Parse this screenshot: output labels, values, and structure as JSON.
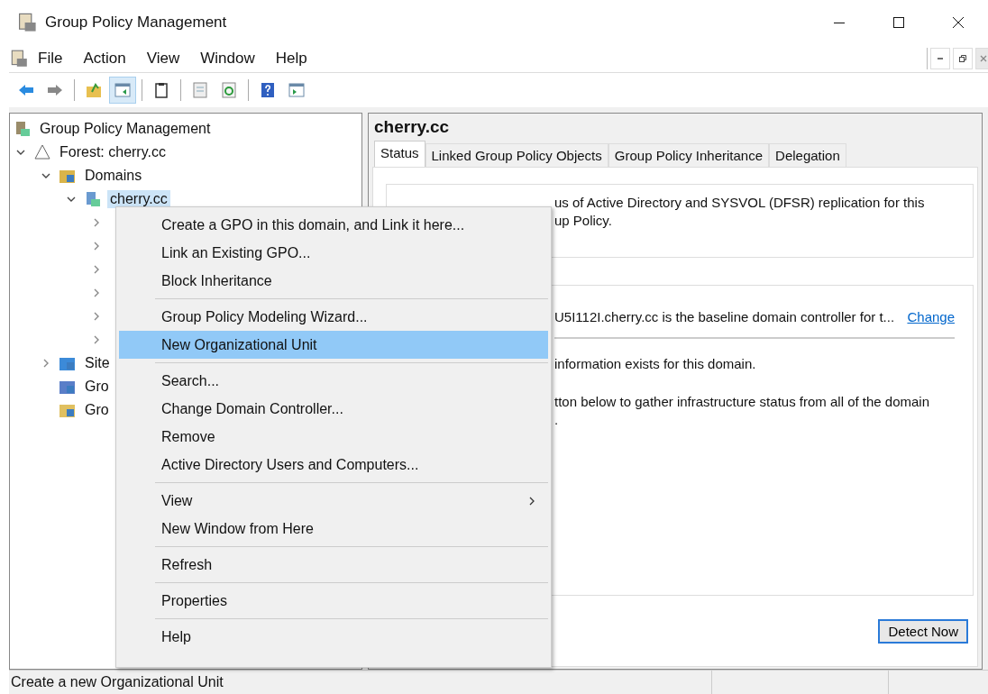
{
  "window": {
    "title": "Group Policy Management"
  },
  "menu_bar": [
    "File",
    "Action",
    "View",
    "Window",
    "Help"
  ],
  "toolbar": [
    {
      "kind": "back",
      "selected": false
    },
    {
      "kind": "forward",
      "selected": false
    },
    {
      "kind": "up",
      "selected": false
    },
    {
      "kind": "tree",
      "selected": true
    },
    {
      "kind": "clipboard",
      "selected": false
    },
    {
      "kind": "export",
      "selected": false
    },
    {
      "kind": "refresh",
      "selected": false
    },
    {
      "kind": "help",
      "selected": false
    },
    {
      "kind": "action",
      "selected": false
    }
  ],
  "tree": [
    {
      "label": "Group Policy Management",
      "kind": "root",
      "selected": false,
      "children": [
        {
          "label": "Forest: cherry.cc",
          "kind": "forest",
          "expanded": true,
          "selected": false,
          "children": [
            {
              "label": "Domains",
              "kind": "domains",
              "expanded": true,
              "selected": false,
              "children": [
                {
                  "label": "cherry.cc",
                  "kind": "domain",
                  "expanded": true,
                  "selected": true,
                  "children": [
                    {
                      "expanded": false
                    },
                    {
                      "expanded": false
                    },
                    {
                      "expanded": false
                    },
                    {
                      "expanded": false
                    },
                    {
                      "expanded": false
                    },
                    {
                      "expanded": false
                    }
                  ]
                }
              ]
            },
            {
              "label": "Site",
              "kind": "sites",
              "expanded": false,
              "selected": false
            },
            {
              "label": "Gro",
              "kind": "gpo",
              "selected": false
            },
            {
              "label": "Gro",
              "kind": "starter",
              "selected": false
            }
          ]
        }
      ]
    }
  ],
  "details": {
    "heading": "cherry.cc",
    "tabs": [
      {
        "label": "Status",
        "selected": true
      },
      {
        "label": "Linked Group Policy Objects",
        "selected": false
      },
      {
        "label": "Group Policy Inheritance",
        "selected": false
      },
      {
        "label": "Delegation",
        "selected": false
      }
    ],
    "intro_lines": [
      "us of Active Directory and SYSVOL (DFSR) replication for this",
      "up Policy."
    ],
    "baseline_text": "U5I112I.cherry.cc is the baseline domain controller for t...",
    "change_link": "Change",
    "status_lines": [
      "information exists for this domain.",
      "tton below to gather infrastructure status from all of the domain",
      "."
    ],
    "detect_button": "Detect Now"
  },
  "context_menu": [
    {
      "kind": "item",
      "label": "Create a GPO in this domain, and Link it here...",
      "submenu": false,
      "selected": false
    },
    {
      "kind": "item",
      "label": "Link an Existing GPO...",
      "submenu": false,
      "selected": false
    },
    {
      "kind": "item",
      "label": "Block Inheritance",
      "submenu": false,
      "selected": false
    },
    {
      "kind": "separator"
    },
    {
      "kind": "item",
      "label": "Group Policy Modeling Wizard...",
      "submenu": false,
      "selected": false
    },
    {
      "kind": "item",
      "label": "New Organizational Unit",
      "submenu": false,
      "selected": true
    },
    {
      "kind": "separator"
    },
    {
      "kind": "item",
      "label": "Search...",
      "submenu": false,
      "selected": false
    },
    {
      "kind": "item",
      "label": "Change Domain Controller...",
      "submenu": false,
      "selected": false
    },
    {
      "kind": "item",
      "label": "Remove",
      "submenu": false,
      "selected": false
    },
    {
      "kind": "item",
      "label": "Active Directory Users and Computers...",
      "submenu": false,
      "selected": false
    },
    {
      "kind": "separator"
    },
    {
      "kind": "item",
      "label": "View",
      "submenu": true,
      "selected": false
    },
    {
      "kind": "item",
      "label": "New Window from Here",
      "submenu": false,
      "selected": false
    },
    {
      "kind": "separator"
    },
    {
      "kind": "item",
      "label": "Refresh",
      "submenu": false,
      "selected": false
    },
    {
      "kind": "separator"
    },
    {
      "kind": "item",
      "label": "Properties",
      "submenu": false,
      "selected": false
    },
    {
      "kind": "separator"
    },
    {
      "kind": "item",
      "label": "Help",
      "submenu": false,
      "selected": false
    }
  ],
  "status_bar": "Create a new Organizational Unit"
}
